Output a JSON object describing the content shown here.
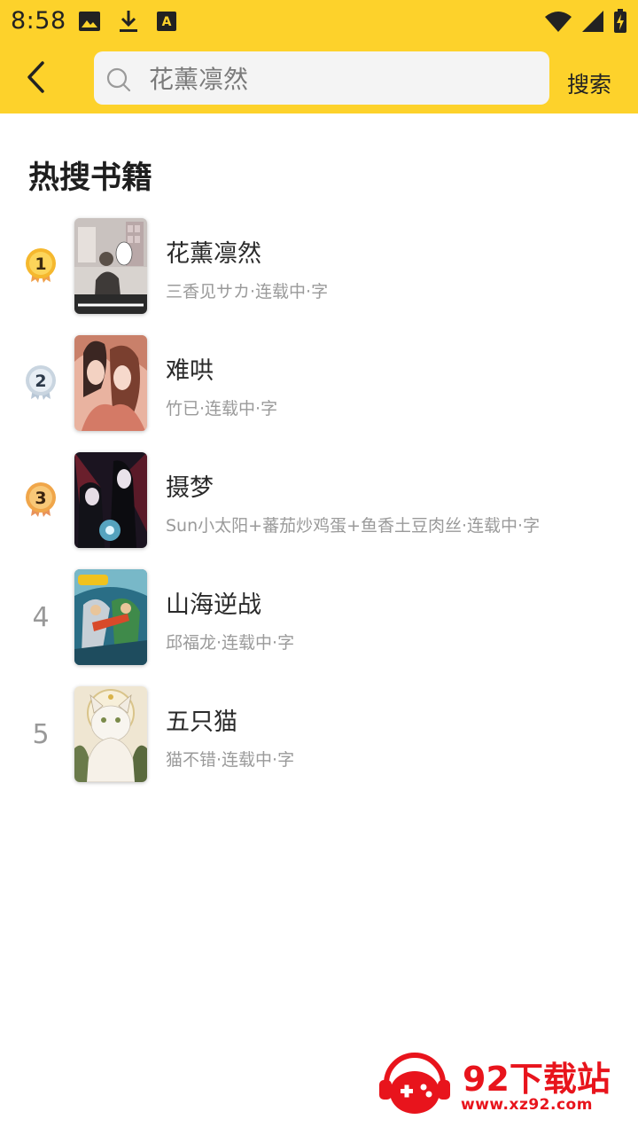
{
  "status_bar": {
    "time": "8:58"
  },
  "header": {
    "search_value": "花薰凛然",
    "search_button_label": "搜索"
  },
  "section": {
    "title": "热搜书籍"
  },
  "books": [
    {
      "rank": "1",
      "title": "花薰凛然",
      "meta": "三香见サカ·连载中·字"
    },
    {
      "rank": "2",
      "title": "难哄",
      "meta": "竹已·连载中·字"
    },
    {
      "rank": "3",
      "title": "摄梦",
      "meta": "Sun小太阳+蕃茄炒鸡蛋+鱼香土豆肉丝·连载中·字"
    },
    {
      "rank": "4",
      "title": "山海逆战",
      "meta": "邱福龙·连载中·字"
    },
    {
      "rank": "5",
      "title": "五只猫",
      "meta": "猫不错·连载中·字"
    }
  ],
  "watermark": {
    "title": "92下载站",
    "url": "www.xz92.com"
  },
  "colors": {
    "header_bg": "#FDD22B",
    "medal_gold": "#F5B82E",
    "medal_silver": "#C9D5E0",
    "medal_bronze": "#F0A64A",
    "watermark_red": "#E8141C"
  }
}
